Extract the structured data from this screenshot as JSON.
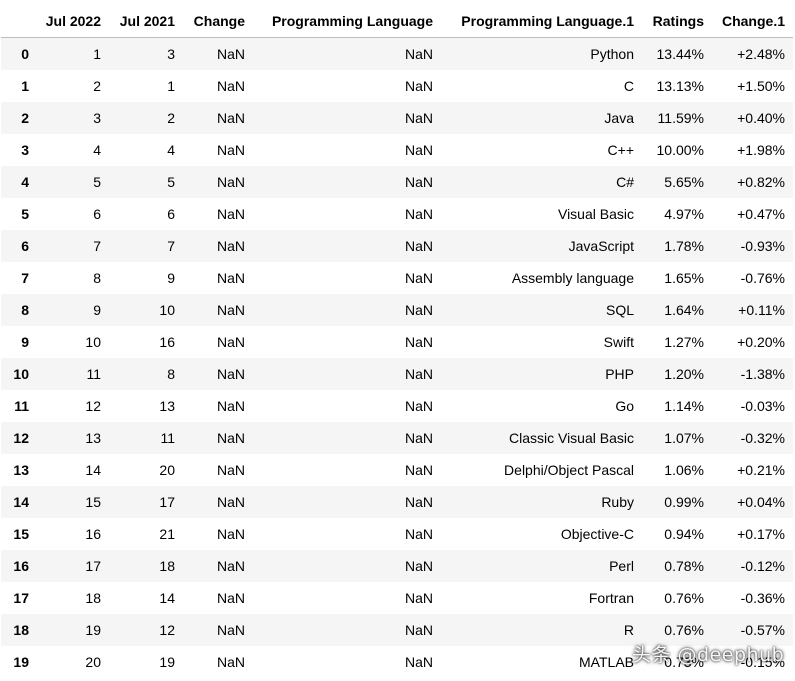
{
  "columns": [
    "",
    "Jul 2022",
    "Jul 2021",
    "Change",
    "Programming Language",
    "Programming Language.1",
    "Ratings",
    "Change.1"
  ],
  "rows": [
    {
      "index": "0",
      "jul2022": "1",
      "jul2021": "3",
      "change": "NaN",
      "lang": "NaN",
      "lang1": "Python",
      "ratings": "13.44%",
      "change1": "+2.48%"
    },
    {
      "index": "1",
      "jul2022": "2",
      "jul2021": "1",
      "change": "NaN",
      "lang": "NaN",
      "lang1": "C",
      "ratings": "13.13%",
      "change1": "+1.50%"
    },
    {
      "index": "2",
      "jul2022": "3",
      "jul2021": "2",
      "change": "NaN",
      "lang": "NaN",
      "lang1": "Java",
      "ratings": "11.59%",
      "change1": "+0.40%"
    },
    {
      "index": "3",
      "jul2022": "4",
      "jul2021": "4",
      "change": "NaN",
      "lang": "NaN",
      "lang1": "C++",
      "ratings": "10.00%",
      "change1": "+1.98%"
    },
    {
      "index": "4",
      "jul2022": "5",
      "jul2021": "5",
      "change": "NaN",
      "lang": "NaN",
      "lang1": "C#",
      "ratings": "5.65%",
      "change1": "+0.82%"
    },
    {
      "index": "5",
      "jul2022": "6",
      "jul2021": "6",
      "change": "NaN",
      "lang": "NaN",
      "lang1": "Visual Basic",
      "ratings": "4.97%",
      "change1": "+0.47%"
    },
    {
      "index": "6",
      "jul2022": "7",
      "jul2021": "7",
      "change": "NaN",
      "lang": "NaN",
      "lang1": "JavaScript",
      "ratings": "1.78%",
      "change1": "-0.93%"
    },
    {
      "index": "7",
      "jul2022": "8",
      "jul2021": "9",
      "change": "NaN",
      "lang": "NaN",
      "lang1": "Assembly language",
      "ratings": "1.65%",
      "change1": "-0.76%"
    },
    {
      "index": "8",
      "jul2022": "9",
      "jul2021": "10",
      "change": "NaN",
      "lang": "NaN",
      "lang1": "SQL",
      "ratings": "1.64%",
      "change1": "+0.11%"
    },
    {
      "index": "9",
      "jul2022": "10",
      "jul2021": "16",
      "change": "NaN",
      "lang": "NaN",
      "lang1": "Swift",
      "ratings": "1.27%",
      "change1": "+0.20%"
    },
    {
      "index": "10",
      "jul2022": "11",
      "jul2021": "8",
      "change": "NaN",
      "lang": "NaN",
      "lang1": "PHP",
      "ratings": "1.20%",
      "change1": "-1.38%"
    },
    {
      "index": "11",
      "jul2022": "12",
      "jul2021": "13",
      "change": "NaN",
      "lang": "NaN",
      "lang1": "Go",
      "ratings": "1.14%",
      "change1": "-0.03%"
    },
    {
      "index": "12",
      "jul2022": "13",
      "jul2021": "11",
      "change": "NaN",
      "lang": "NaN",
      "lang1": "Classic Visual Basic",
      "ratings": "1.07%",
      "change1": "-0.32%"
    },
    {
      "index": "13",
      "jul2022": "14",
      "jul2021": "20",
      "change": "NaN",
      "lang": "NaN",
      "lang1": "Delphi/Object Pascal",
      "ratings": "1.06%",
      "change1": "+0.21%"
    },
    {
      "index": "14",
      "jul2022": "15",
      "jul2021": "17",
      "change": "NaN",
      "lang": "NaN",
      "lang1": "Ruby",
      "ratings": "0.99%",
      "change1": "+0.04%"
    },
    {
      "index": "15",
      "jul2022": "16",
      "jul2021": "21",
      "change": "NaN",
      "lang": "NaN",
      "lang1": "Objective-C",
      "ratings": "0.94%",
      "change1": "+0.17%"
    },
    {
      "index": "16",
      "jul2022": "17",
      "jul2021": "18",
      "change": "NaN",
      "lang": "NaN",
      "lang1": "Perl",
      "ratings": "0.78%",
      "change1": "-0.12%"
    },
    {
      "index": "17",
      "jul2022": "18",
      "jul2021": "14",
      "change": "NaN",
      "lang": "NaN",
      "lang1": "Fortran",
      "ratings": "0.76%",
      "change1": "-0.36%"
    },
    {
      "index": "18",
      "jul2022": "19",
      "jul2021": "12",
      "change": "NaN",
      "lang": "NaN",
      "lang1": "R",
      "ratings": "0.76%",
      "change1": "-0.57%"
    },
    {
      "index": "19",
      "jul2022": "20",
      "jul2021": "19",
      "change": "NaN",
      "lang": "NaN",
      "lang1": "MATLAB",
      "ratings": "0.73%",
      "change1": "-0.15%"
    }
  ],
  "watermark": "头条 @deephub"
}
